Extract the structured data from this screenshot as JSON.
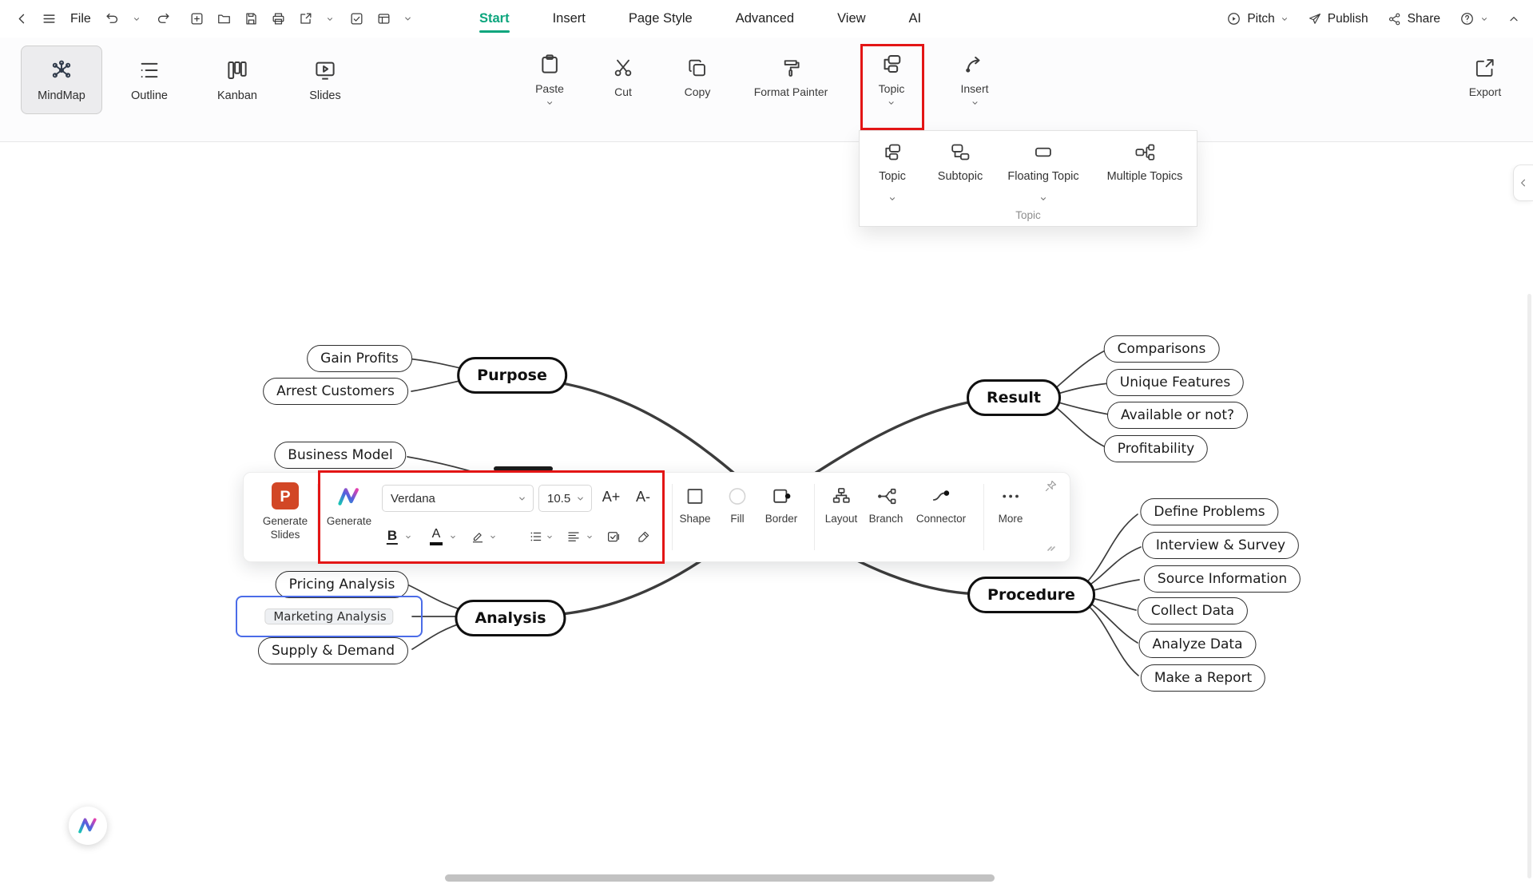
{
  "topbar": {
    "file_label": "File",
    "tabs": [
      {
        "label": "Start",
        "active": true
      },
      {
        "label": "Insert"
      },
      {
        "label": "Page Style"
      },
      {
        "label": "Advanced"
      },
      {
        "label": "View"
      },
      {
        "label": "AI"
      }
    ],
    "pitch_label": "Pitch",
    "publish_label": "Publish",
    "share_label": "Share"
  },
  "ribbon": {
    "modes": [
      "MindMap",
      "Outline",
      "Kanban",
      "Slides"
    ],
    "active_mode": "MindMap",
    "paste_label": "Paste",
    "cut_label": "Cut",
    "copy_label": "Copy",
    "format_painter_label": "Format Painter",
    "topic_label": "Topic",
    "insert_label": "Insert",
    "export_label": "Export"
  },
  "topic_dropdown": {
    "items": [
      "Topic",
      "Subtopic",
      "Floating Topic",
      "Multiple Topics"
    ],
    "group_label": "Topic"
  },
  "toolbar": {
    "generate_slides_label": "Generate Slides",
    "generate_label": "Generate",
    "font_family": "Verdana",
    "font_size": "10.5",
    "increase_font": "A+",
    "decrease_font": "A-",
    "bold": "B",
    "font_color": "A",
    "shape_label": "Shape",
    "fill_label": "Fill",
    "border_label": "Border",
    "layout_label": "Layout",
    "branch_label": "Branch",
    "connector_label": "Connector",
    "more_label": "More"
  },
  "mindmap": {
    "topics": [
      {
        "label": "Purpose"
      },
      {
        "label": "Analysis"
      },
      {
        "label": "Result"
      },
      {
        "label": "Procedure"
      }
    ],
    "subtopics": [
      {
        "label": "Gain Profits"
      },
      {
        "label": "Arrest Customers"
      },
      {
        "label": "Business Model"
      },
      {
        "label": "Pricing Analysis"
      },
      {
        "label": "Marketing Analysis",
        "selected": true
      },
      {
        "label": "Supply & Demand"
      },
      {
        "label": "Comparisons"
      },
      {
        "label": "Unique Features"
      },
      {
        "label": "Available or not?"
      },
      {
        "label": "Profitability"
      },
      {
        "label": "Define Problems"
      },
      {
        "label": "Interview & Survey"
      },
      {
        "label": "Source Information"
      },
      {
        "label": "Collect Data"
      },
      {
        "label": "Analyze Data"
      },
      {
        "label": "Make a Report"
      }
    ]
  },
  "colors": {
    "accent_green": "#0ba57d",
    "highlight_red": "#e31515",
    "selection_blue": "#4b6ce8",
    "powerpoint_orange": "#d24726"
  }
}
